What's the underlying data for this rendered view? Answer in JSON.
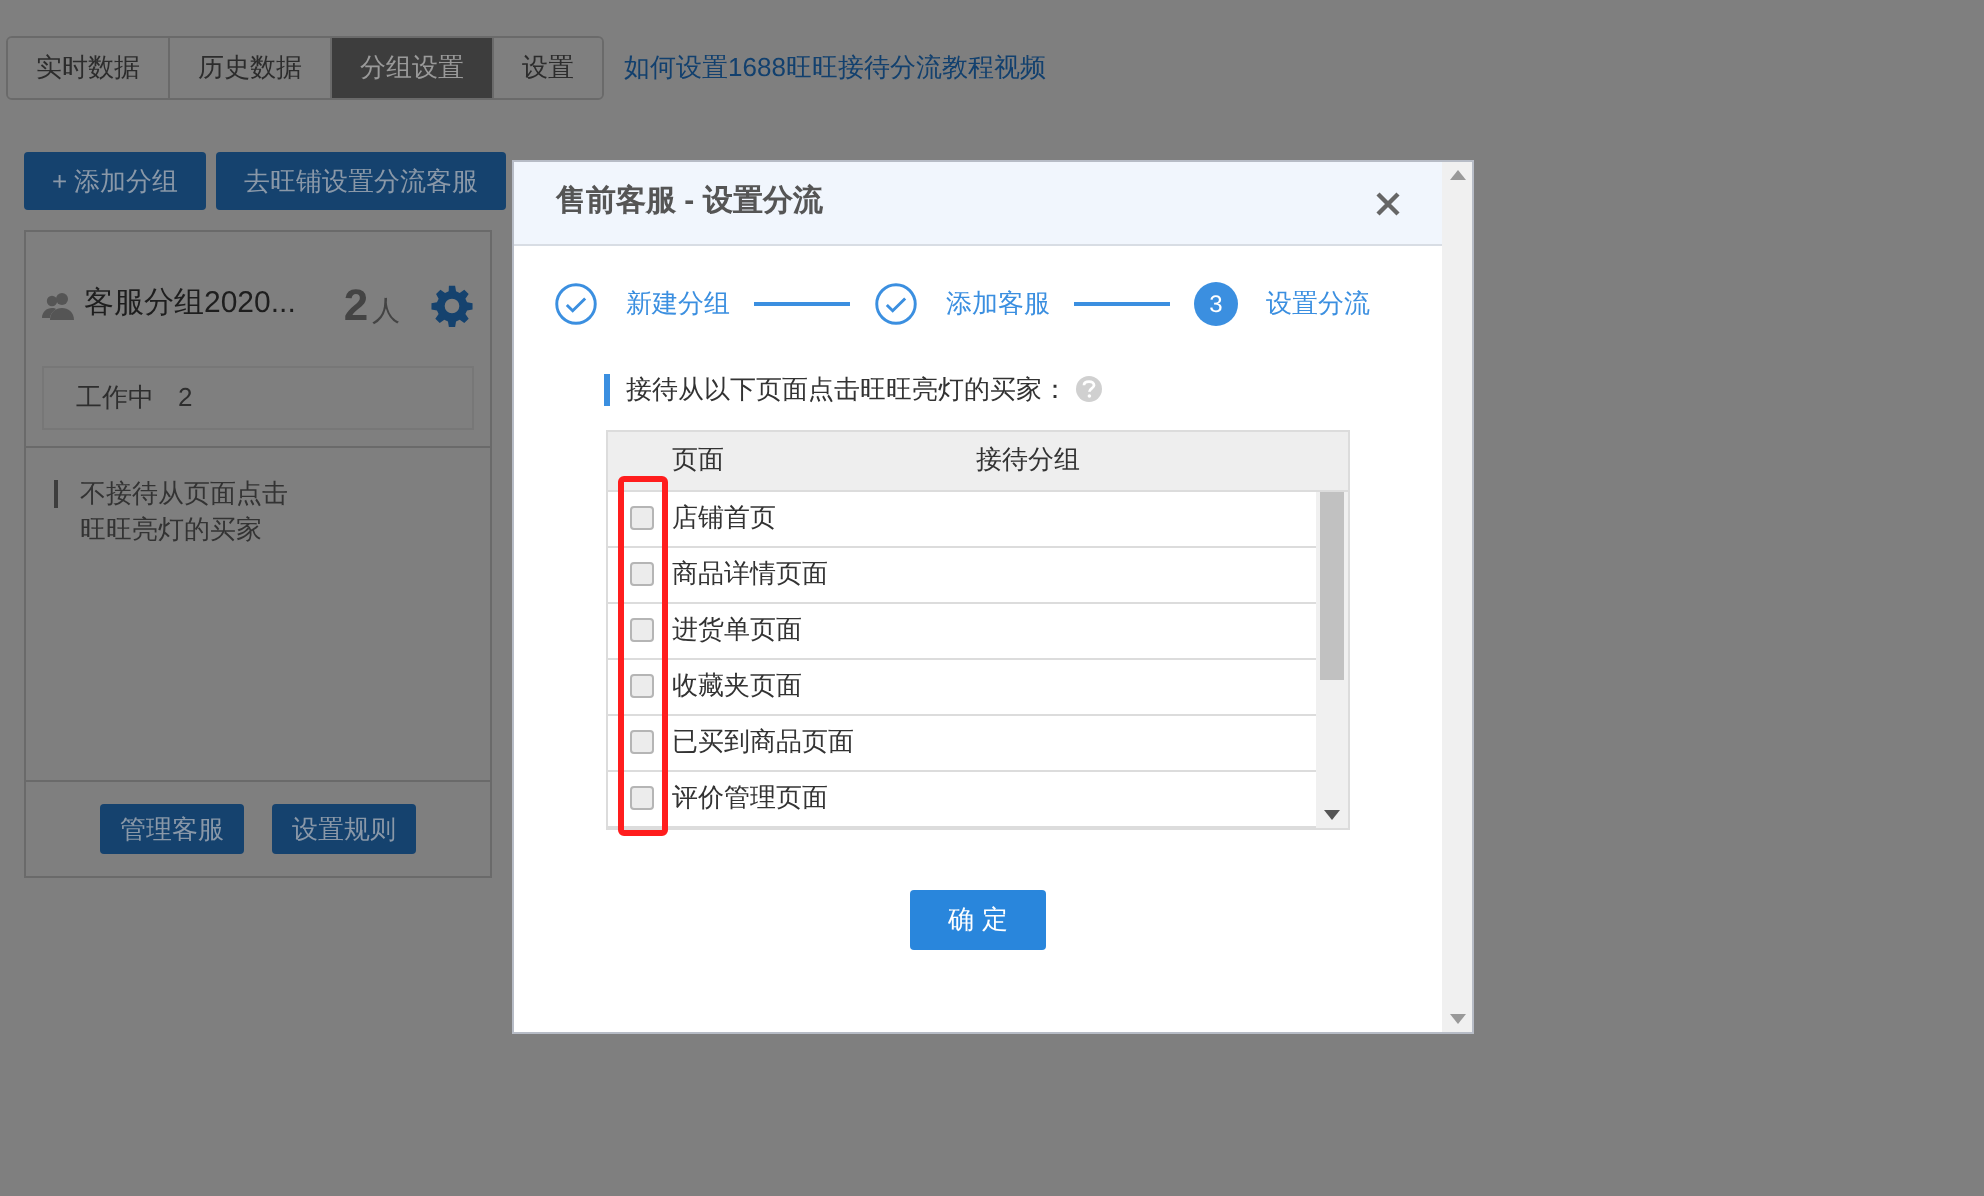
{
  "tabs": [
    {
      "label": "实时数据",
      "selected": false
    },
    {
      "label": "历史数据",
      "selected": false
    },
    {
      "label": "分组设置",
      "selected": true
    },
    {
      "label": "设置",
      "selected": false
    }
  ],
  "help_link": "如何设置1688旺旺接待分流教程视频",
  "actions": [
    "+ 添加分组",
    "去旺铺设置分流客服"
  ],
  "group_card": {
    "name": "客服分组2020...",
    "count": "2",
    "unit": "人",
    "status_label": "工作中",
    "status_count": "2",
    "note": "不接待从页面点击旺旺亮灯的买家",
    "buttons": [
      "管理客服",
      "设置规则"
    ]
  },
  "dialog": {
    "title": "售前客服 - 设置分流",
    "steps": [
      {
        "label": "新建分组",
        "kind": "done"
      },
      {
        "label": "添加客服",
        "kind": "done"
      },
      {
        "label": "设置分流",
        "kind": "current",
        "number": "3"
      }
    ],
    "section_label": "接待从以下页面点击旺旺亮灯的买家：",
    "table": {
      "columns": [
        "页面",
        "接待分组"
      ],
      "rows": [
        {
          "page": "店铺首页",
          "checked": false
        },
        {
          "page": "商品详情页面",
          "checked": false
        },
        {
          "page": "进货单页面",
          "checked": false
        },
        {
          "page": "收藏夹页面",
          "checked": false
        },
        {
          "page": "已买到商品页面",
          "checked": false
        },
        {
          "page": "评价管理页面",
          "checked": false
        }
      ]
    },
    "confirm": "确 定"
  }
}
